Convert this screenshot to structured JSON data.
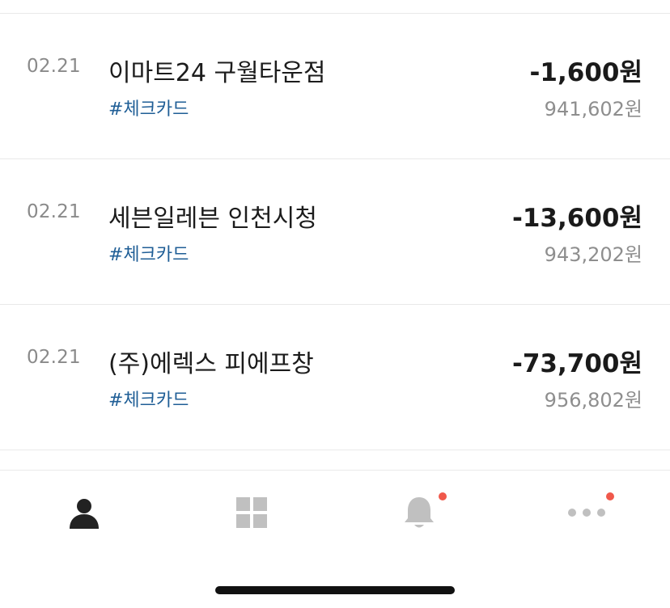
{
  "transactions": [
    {
      "date": "02.21",
      "merchant": "이마트24 구월타운점",
      "tag": "#체크카드",
      "amount": "-1,600원",
      "balance": "941,602원"
    },
    {
      "date": "02.21",
      "merchant": "세븐일레븐 인천시청",
      "tag": "#체크카드",
      "amount": "-13,600원",
      "balance": "943,202원"
    },
    {
      "date": "02.21",
      "merchant": "(주)에렉스 피에프창",
      "tag": "#체크카드",
      "amount": "-73,700원",
      "balance": "956,802원"
    }
  ],
  "tabbar": {
    "tabs": [
      {
        "icon": "person-icon",
        "active": true
      },
      {
        "icon": "grid-icon",
        "active": false
      },
      {
        "icon": "bell-icon",
        "active": false,
        "badge": true
      },
      {
        "icon": "more-dots-icon",
        "active": false,
        "badge": true
      }
    ],
    "colors": {
      "active": "#222222",
      "inactive": "#c0c0c0",
      "badge": "#f0584b"
    }
  }
}
